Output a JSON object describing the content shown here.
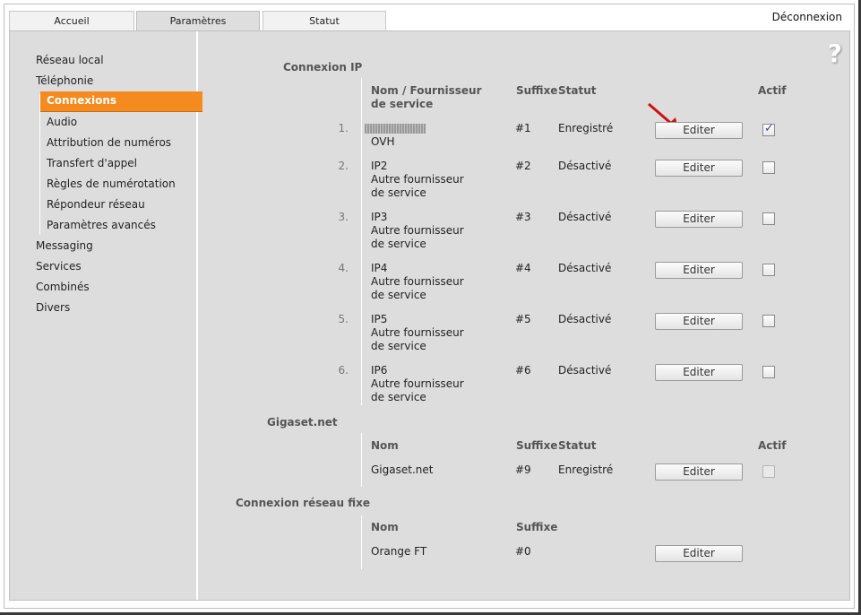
{
  "tabs": [
    {
      "label": "Accueil"
    },
    {
      "label": "Paramètres"
    },
    {
      "label": "Statut"
    }
  ],
  "logout_label": "Déconnexion",
  "help_label": "?",
  "sidebar": {
    "items": [
      {
        "label": "Réseau local"
      },
      {
        "label": "Téléphonie"
      },
      {
        "label": "Messaging"
      },
      {
        "label": "Services"
      },
      {
        "label": "Combinés"
      },
      {
        "label": "Divers"
      }
    ],
    "subitems": [
      {
        "label": "Connexions"
      },
      {
        "label": "Audio"
      },
      {
        "label": "Attribution de numéros"
      },
      {
        "label": "Transfert d'appel"
      },
      {
        "label": "Règles de numérotation"
      },
      {
        "label": "Répondeur réseau"
      },
      {
        "label": "Paramètres avancés"
      }
    ]
  },
  "ip": {
    "title": "Connexion IP",
    "headers": {
      "name": "Nom / Fournisseur de service",
      "suffix": "Suffixe",
      "status": "Statut",
      "active": "Actif"
    },
    "rows": [
      {
        "num": "1.",
        "line1": "",
        "line2": "OVH",
        "suffix": "#1",
        "status": "Enregistré",
        "button": "Editer",
        "checked": true
      },
      {
        "num": "2.",
        "line1": "IP2",
        "line2": "Autre fournisseur de service",
        "suffix": "#2",
        "status": "Désactivé",
        "button": "Editer",
        "checked": false
      },
      {
        "num": "3.",
        "line1": "IP3",
        "line2": "Autre fournisseur de service",
        "suffix": "#3",
        "status": "Désactivé",
        "button": "Editer",
        "checked": false
      },
      {
        "num": "4.",
        "line1": "IP4",
        "line2": "Autre fournisseur de service",
        "suffix": "#4",
        "status": "Désactivé",
        "button": "Editer",
        "checked": false
      },
      {
        "num": "5.",
        "line1": "IP5",
        "line2": "Autre fournisseur de service",
        "suffix": "#5",
        "status": "Désactivé",
        "button": "Editer",
        "checked": false
      },
      {
        "num": "6.",
        "line1": "IP6",
        "line2": "Autre fournisseur de service",
        "suffix": "#6",
        "status": "Désactivé",
        "button": "Editer",
        "checked": false
      }
    ]
  },
  "gigaset": {
    "title": "Gigaset.net",
    "headers": {
      "name": "Nom",
      "suffix": "Suffixe",
      "status": "Statut",
      "active": "Actif"
    },
    "row": {
      "name": "Gigaset.net",
      "suffix": "#9",
      "status": "Enregistré",
      "button": "Editer",
      "checked": false
    }
  },
  "fixed": {
    "title": "Connexion réseau fixe",
    "headers": {
      "name": "Nom",
      "suffix": "Suffixe"
    },
    "row": {
      "name": "Orange FT",
      "suffix": "#0",
      "button": "Editer"
    }
  },
  "colors": {
    "accent": "#f58a1f",
    "arrow": "#d01010"
  }
}
